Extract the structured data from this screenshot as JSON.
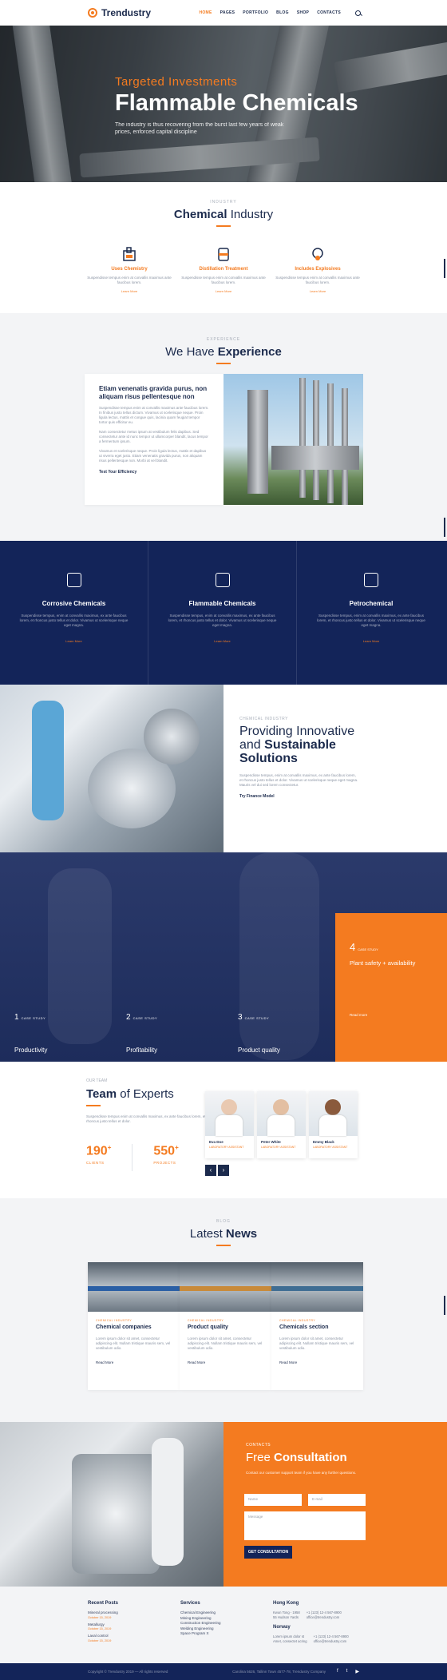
{
  "brand": {
    "name": "Trendustry"
  },
  "nav": {
    "items": [
      "HOME",
      "PAGES",
      "PORTFOLIO",
      "BLOG",
      "SHOP",
      "CONTACTS"
    ]
  },
  "hero": {
    "subtitle": "Targeted Investments",
    "title": "Flammable Chemicals",
    "text": "The industry is thus recovering from the burst last few years of weak prices, enforced capital discipline"
  },
  "industry": {
    "label": "INDUSTRY",
    "title_bold": "Chemical",
    "title_rest": " Industry",
    "items": [
      {
        "title": "Uses Chemistry",
        "text": "Suspendisse tempus enim at convallis maximus ante faucibus lorem.",
        "link": "Learn More"
      },
      {
        "title": "Distillation Treatment",
        "text": "Suspendisse tempus enim at convallis maximus ante faucibus lorem.",
        "link": "Learn More"
      },
      {
        "title": "Includes Explosives",
        "text": "Suspendisse tempus enim at convallis maximus ante faucibus lorem.",
        "link": "Learn More"
      }
    ]
  },
  "experience": {
    "label": "EXPERIENCE",
    "title_rest": "We Have ",
    "title_bold": "Experience",
    "card_title": "Etiam venenatis gravida purus, non aliquam risus pellentesque non",
    "paragraphs": [
      "Suspendisse tempus enim at convallis maximus ante faucibus lorem. In finibus justo tellus dictum. Vivamus ut scelerisque neque. Proin ligula lectus, mattis et congue quis, lacinia quam feugiat tempor tortor quis efficitur eu.",
      "Nam consectetur metus ipsum at vestibulum felis dapibus. Sed consectetur ante id nunc tempor ut ullamcorper blandit, lacus tempor a fermentum ipsum.",
      "Vivamus et scelerisque neque. Proin ligula lectus, mattis et dapibus ut viverra eget justo. Etiam venenatis gravida purus, non aliquam risus pellentesque non. Morbi at vel blandit."
    ],
    "link": "Test Your Efficiency"
  },
  "services": [
    {
      "title": "Corrosive Chemicals",
      "text": "Suspendisse tempus, enim at convallis maximus, ex ante faucibus lorem, et rhoncus justo tellus et dolor. Vivamus ut scelerisque neque eget magna.",
      "link": "Learn More"
    },
    {
      "title": "Flammable Chemicals",
      "text": "Suspendisse tempus, enim at convallis maximus, ex ante faucibus lorem, et rhoncus justo tellus et dolor. Vivamus ut scelerisque neque eget magna.",
      "link": "Learn More"
    },
    {
      "title": "Petrochemical",
      "text": "Suspendisse tempus, enim at convallis maximus, ex ante faucibus lorem, et rhoncus justo tellus et dolor. Vivamus ut scelerisque neque eget magna.",
      "link": "Learn More"
    }
  ],
  "innovative": {
    "label": "CHEMICAL INDUSTRY",
    "title_line1": "Providing Innovative",
    "title_line2_pre": "and ",
    "title_line2_bold": "Sustainable",
    "title_line3": "Solutions",
    "text": "Suspendisse tempus, enim at convallis maximus, ex ante faucibus lorem, et rhoncus justo tellus et dolor. Vivamus ut scelerisque neque eget magna. Mauris vel dui sed lorem consectetur.",
    "link": "Try Finance Model"
  },
  "cases": {
    "tag": "CASE STUDY",
    "items": [
      {
        "num": "1",
        "title": "Productivity"
      },
      {
        "num": "2",
        "title": "Profitability"
      },
      {
        "num": "3",
        "title": "Product quality"
      },
      {
        "num": "4",
        "title": "Plant safety + availability",
        "link": "Read more"
      }
    ]
  },
  "team": {
    "label": "OUR TEAM",
    "title_bold": "Team",
    "title_rest": " of Experts",
    "text": "Suspendisse tempus enim at convallis maximus, ex ante faucibus lorem, et rhoncus justo tellus et dolor.",
    "stats": [
      {
        "value": "190",
        "label": "CLIENTS"
      },
      {
        "value": "550",
        "label": "PROJECTS"
      }
    ],
    "members": [
      {
        "name": "Eva Doe",
        "role": "LABORATORY ASSISTANT"
      },
      {
        "name": "Peter White",
        "role": "LABORATORY ASSISTANT"
      },
      {
        "name": "Emmy Black",
        "role": "LABORATORY ASSISTANT"
      }
    ]
  },
  "news": {
    "label": "BLOG",
    "title_rest": "Latest ",
    "title_bold": "News",
    "items": [
      {
        "cat": "CHEMICAL INDUSTRY",
        "title": "Chemical companies",
        "text": "Lorem ipsum dolor sit amet, consectetur adipiscing elit. Nullam tristique mauris sem, vel vestibulum odio.",
        "link": "Read More"
      },
      {
        "cat": "CHEMICAL INDUSTRY",
        "title": "Product quality",
        "text": "Lorem ipsum dolor sit amet, consectetur adipiscing elit. Nullam tristique mauris sem, vel vestibulum odio.",
        "link": "Read More"
      },
      {
        "cat": "CHEMICAL INDUSTRY",
        "title": "Chemicals section",
        "text": "Lorem ipsum dolor sit amet, consectetur adipiscing elit. Nullam tristique mauris sem, vel vestibulum odio.",
        "link": "Read More"
      }
    ]
  },
  "consult": {
    "label": "CONTACTS",
    "title_rest": "Free ",
    "title_bold": "Consultation",
    "text": "Contact our customer support team if you have any further questions.",
    "name_ph": "Name",
    "email_ph": "E-mail",
    "message_ph": "Message",
    "button": "GET CONSULTATION"
  },
  "footer": {
    "recent_title": "Recent Posts",
    "recent": [
      {
        "title": "Mineral processing",
        "date": "October 15, 2019"
      },
      {
        "title": "Metallurgy",
        "date": "October 15, 2019"
      },
      {
        "title": "Laval control",
        "date": "October 15, 2019"
      }
    ],
    "services_title": "Services",
    "services": [
      "Chemical Engineering",
      "Mining Engineering",
      "Construction Engineering",
      "Welding Engineering",
      "Space Program X"
    ],
    "hk_title": "Hong Kong",
    "hk_addr": [
      "Kwun Tong - 1958",
      "55 Hudson Yards"
    ],
    "hk_contact": [
      "+1 (123) 12-4 567-8900",
      "office@trendustry.com"
    ],
    "no_title": "Norway",
    "no_addr": [
      "Lorem ipsum dolor st",
      "Amet, consectet acring"
    ],
    "no_contact": [
      "+1 (123) 12-4 567-8900",
      "office@trendustry.com"
    ],
    "copyright": "Copyright © Trendustry 2019 — All rights reserved",
    "address": "Carolina 5626, Tallinn Town 4577-78, Trendustry Company"
  },
  "colors": {
    "accent": "#f47b20",
    "navy": "#132459",
    "text": "#1c2b4d"
  }
}
